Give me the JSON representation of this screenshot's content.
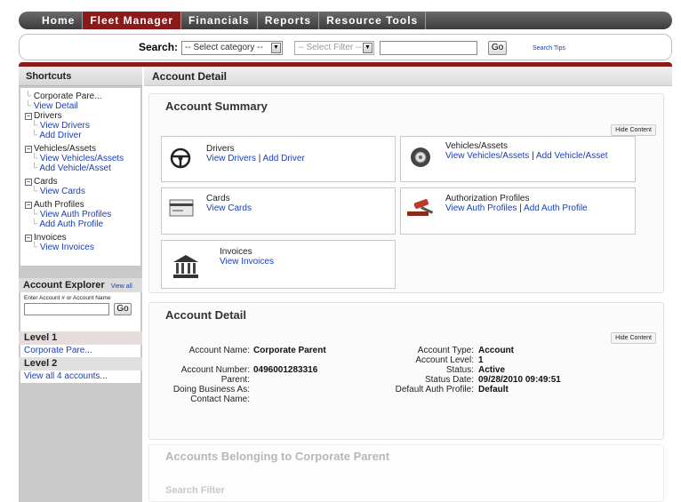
{
  "nav": {
    "items": [
      "Home",
      "Fleet Manager",
      "Financials",
      "Reports",
      "Resource Tools"
    ],
    "active_index": 1
  },
  "search": {
    "label": "Search:",
    "category_select": "-- Select category --",
    "filter_select": "-- Select Filter --",
    "go_label": "Go",
    "tips_label": "Search Tips"
  },
  "sidebar": {
    "title": "Shortcuts",
    "tree": {
      "root": "Corporate Pare...",
      "view_detail": "View Detail",
      "drivers": "Drivers",
      "view_drivers": "View Drivers",
      "add_driver": "Add Driver",
      "vehicles": "Vehicles/Assets",
      "view_vehicles": "View Vehicles/Assets",
      "add_vehicle": "Add Vehicle/Asset",
      "cards": "Cards",
      "view_cards": "View Cards",
      "auth_profiles": "Auth Profiles",
      "view_auth_profiles": "View Auth Profiles",
      "add_auth_profile": "Add Auth Profile",
      "invoices": "Invoices",
      "view_invoices": "View Invoices"
    }
  },
  "explorer": {
    "title": "Account Explorer",
    "view_all": "View all",
    "hint": "Enter Account # or Account Name",
    "go_label": "Go",
    "level1_title": "Level 1",
    "level1_item": "Corporate Pare...",
    "level2_title": "Level 2",
    "level2_item": "View all 4 accounts..."
  },
  "main": {
    "title": "Account Detail",
    "summary": {
      "title": "Account Summary",
      "hide_label": "Hide Content",
      "drivers": {
        "title": "Drivers",
        "link1": "View Drivers",
        "sep": " | ",
        "link2": "Add Driver"
      },
      "vehicles": {
        "title": "Vehicles/Assets",
        "link1": "View Vehicles/Assets",
        "sep": " | ",
        "link2": "Add Vehicle/Asset"
      },
      "cards": {
        "title": "Cards",
        "link1": "View Cards"
      },
      "auth": {
        "title": "Authorization Profiles",
        "link1": "View Auth Profiles",
        "sep": " | ",
        "link2": "Add Auth Profile"
      },
      "invoices": {
        "title": "Invoices",
        "link1": "View Invoices"
      }
    },
    "detail": {
      "title": "Account Detail",
      "hide_label": "Hide Content",
      "account_name_label": "Account Name:",
      "account_name": "Corporate Parent",
      "account_number_label": "Account Number:",
      "account_number": "0496001283316",
      "parent_label": "Parent:",
      "dba_label": "Doing Business As:",
      "contact_label": "Contact Name:",
      "account_type_label": "Account Type:",
      "account_type": "Account",
      "account_level_label": "Account Level:",
      "account_level": "1",
      "status_label": "Status:",
      "status": "Active",
      "status_date_label": "Status Date:",
      "status_date": "09/28/2010 09:49:51",
      "default_auth_label": "Default Auth Profile:",
      "default_auth": "Default"
    },
    "belonging": {
      "title": "Accounts Belonging to Corporate Parent",
      "filter_title": "Search Filter"
    }
  }
}
